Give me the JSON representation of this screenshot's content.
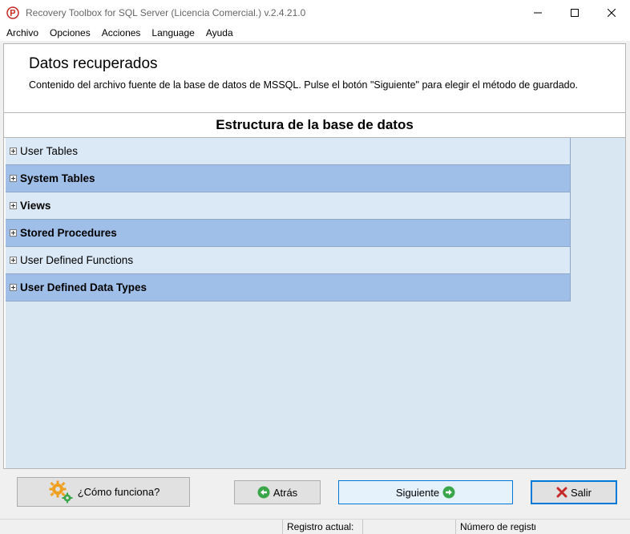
{
  "window": {
    "title": "Recovery Toolbox for SQL Server (Licencia Comercial.) v.2.4.21.0"
  },
  "menu": [
    "Archivo",
    "Opciones",
    "Acciones",
    "Language",
    "Ayuda"
  ],
  "header": {
    "title": "Datos recuperados",
    "description": "Contenido del archivo fuente de la base de datos de MSSQL. Pulse el botón \"Siguiente\" para elegir el método de guardado."
  },
  "structure": {
    "title": "Estructura de la base de datos",
    "items": [
      {
        "label": "User Tables"
      },
      {
        "label": "System Tables"
      },
      {
        "label": "Views"
      },
      {
        "label": "Stored Procedures"
      },
      {
        "label": "User Defined Functions"
      },
      {
        "label": "User Defined Data Types"
      }
    ]
  },
  "buttons": {
    "how": "¿Cómo funciona?",
    "back": "Atrás",
    "next": "Siguiente",
    "exit": "Salir"
  },
  "status": {
    "current_record": "Registro actual:",
    "record_number": "Número de registr"
  },
  "colors": {
    "row_light": "#dbe8f5",
    "row_dark": "#9fbfe8",
    "tree_bg": "#d9e7f3",
    "accent": "#0078d7"
  },
  "icons": [
    "app-icon",
    "minimize-icon",
    "maximize-icon",
    "close-icon",
    "gears-icon",
    "arrow-left-icon",
    "arrow-right-icon",
    "x-icon"
  ]
}
